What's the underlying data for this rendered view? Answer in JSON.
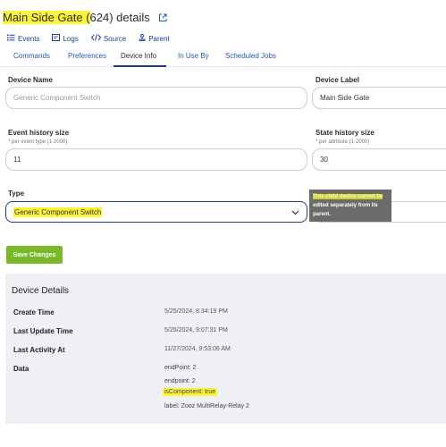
{
  "header": {
    "title_main": "Main Side Gate (",
    "title_id": "624) details"
  },
  "toolbar": {
    "events": "Events",
    "logs": "Logs",
    "source": "Source",
    "parent": "Parent"
  },
  "tabs": [
    "Commands",
    "Preferences",
    "Device Info",
    "In Use By",
    "Scheduled Jobs"
  ],
  "form": {
    "device_name_label": "Device Name",
    "device_name_value": "Generic Component Switch",
    "device_label_label": "Device Label",
    "device_label_value": "Main Side Gate",
    "event_history_label": "Event history size",
    "event_history_hint": "* per event type (1-2000)",
    "event_history_value": "11",
    "state_history_label": "State history size",
    "state_history_hint": "* per attribute (1-2000)",
    "state_history_value": "30",
    "type_label": "Type",
    "type_value": "Generic Component Switch",
    "tooltip_line1": "This child device cannot be",
    "tooltip_line2": "edited separately from its",
    "tooltip_line3": "parent."
  },
  "save_button": "Save Changes",
  "details": {
    "title": "Device Details",
    "create_time_label": "Create Time",
    "create_time_value": "5/25/2024, 8:34:19 PM",
    "last_update_label": "Last Update Time",
    "last_update_value": "5/25/2024, 9:07:31 PM",
    "last_activity_label": "Last Activity At",
    "last_activity_value": "11/27/2024, 9:53:06 AM",
    "data_label": "Data",
    "data_lines": [
      "endPoint: 2",
      "endpoint: 2",
      "isComponent: true",
      "label: Zooz MultiRelay-Relay 2"
    ]
  },
  "colors": {
    "highlight": "#fbf33a",
    "link": "#1e59b5",
    "save_button": "#78b829",
    "panel_bg": "#eff0f4"
  },
  "icons": [
    "external-link-icon",
    "list-icon",
    "logs-icon",
    "code-icon",
    "parent-icon",
    "chevron-down-icon"
  ]
}
